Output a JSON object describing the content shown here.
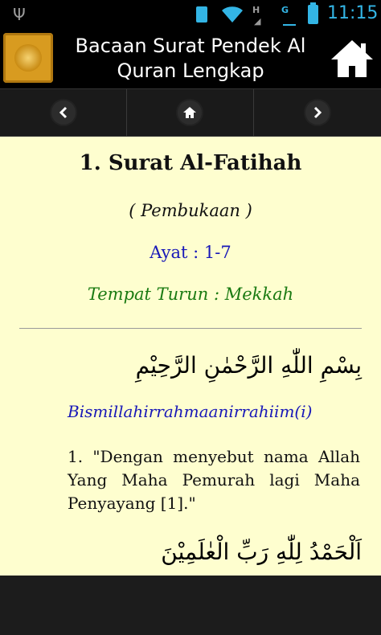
{
  "status_bar": {
    "time": "11:15",
    "icons": [
      "usb-icon",
      "sd-card-icon",
      "wifi-icon",
      "signal-icon",
      "signal-icon",
      "battery-icon"
    ]
  },
  "app_bar": {
    "title": "Bacaan Surat Pendek Al Quran Lengkap",
    "icons": [
      "app-logo-icon",
      "home-icon"
    ]
  },
  "nav": {
    "icons": [
      "chevron-left-icon",
      "home-icon",
      "chevron-right-icon"
    ]
  },
  "surah": {
    "title": "1. Surat Al-Fatihah",
    "meaning": "( Pembukaan )",
    "ayat": "Ayat : 1-7",
    "tempat": "Tempat Turun : Mekkah"
  },
  "verses": [
    {
      "arabic": "بِسْمِ اللّٰهِ الرَّحْمٰنِ الرَّحِيْمِ",
      "transliteration": "Bismillahirrahmaanirrahiim(i)",
      "translation": "1. \"Dengan menyebut nama Allah Yang Maha Pemurah lagi Maha Penyayang [1].\""
    },
    {
      "arabic": "اَلْحَمْدُ لِلّٰهِ رَبِّ الْعٰلَمِيْنَ"
    }
  ],
  "colors": {
    "content_background": "#fefecf",
    "ayat_text": "#1818b8",
    "tempat_text": "#1a7a12",
    "status_accent": "#33b5e5"
  }
}
